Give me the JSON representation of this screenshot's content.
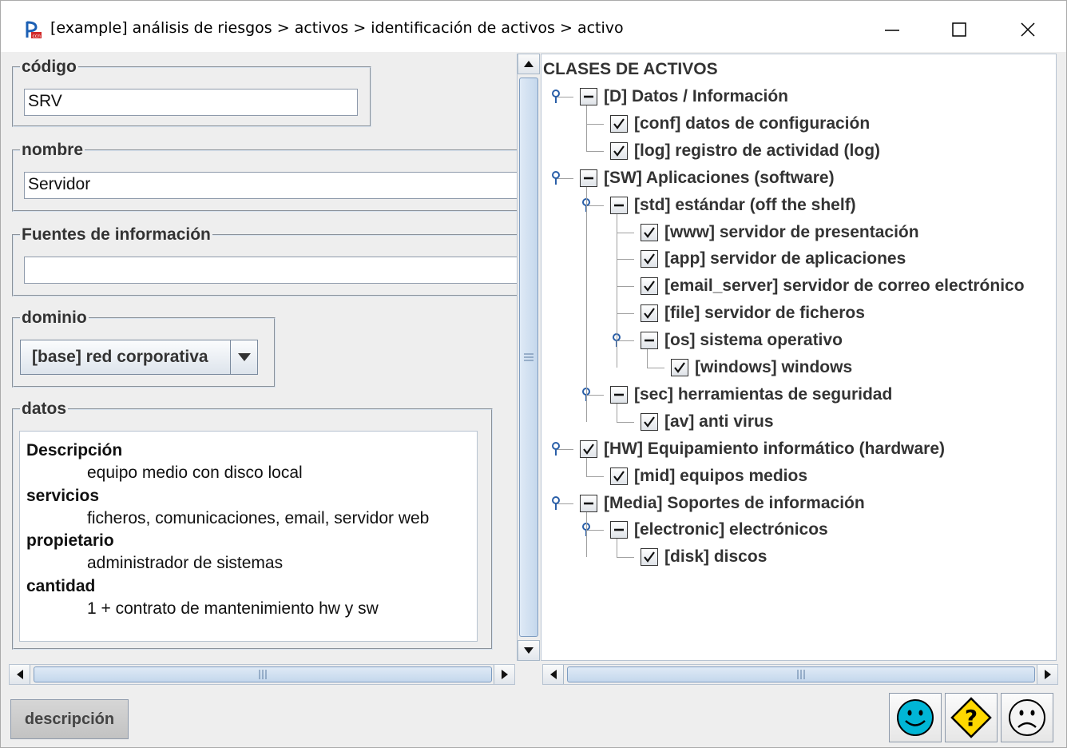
{
  "window": {
    "title": "[example] análisis de riesgos > activos > identificación de activos > activo",
    "icon": "pilar-app-icon"
  },
  "form": {
    "codigo": {
      "label": "código",
      "value": "SRV"
    },
    "nombre": {
      "label": "nombre",
      "value": "Servidor"
    },
    "fuentes": {
      "label": "Fuentes de información",
      "value": ""
    },
    "dominio": {
      "label": "dominio",
      "selected": "[base] red corporativa"
    },
    "datos": {
      "label": "datos",
      "lines": [
        {
          "text": "Descripción",
          "kind": "hd"
        },
        {
          "text": "equipo medio con disco local",
          "kind": "val"
        },
        {
          "text": "servicios",
          "kind": "hd"
        },
        {
          "text": "ficheros, comunicaciones, email, servidor web",
          "kind": "val"
        },
        {
          "text": "propietario",
          "kind": "hd"
        },
        {
          "text": "administrador de sistemas",
          "kind": "val"
        },
        {
          "text": "cantidad",
          "kind": "hd"
        },
        {
          "text": "1 + contrato de mantenimiento hw y sw",
          "kind": "val"
        }
      ]
    }
  },
  "tree": {
    "root": "CLASES DE ACTIVOS",
    "nodes": [
      {
        "label": "[D] Datos / Información",
        "level": 0,
        "state": "partial",
        "expandable": true
      },
      {
        "label": "[conf] datos de configuración",
        "level": 1,
        "state": "checked",
        "expandable": false
      },
      {
        "label": "[log] registro de actividad (log)",
        "level": 1,
        "state": "checked",
        "expandable": false
      },
      {
        "label": "[SW] Aplicaciones (software)",
        "level": 0,
        "state": "partial",
        "expandable": true
      },
      {
        "label": "[std] estándar (off the shelf)",
        "level": 1,
        "state": "partial",
        "expandable": true
      },
      {
        "label": "[www] servidor de presentación",
        "level": 2,
        "state": "checked",
        "expandable": false
      },
      {
        "label": "[app] servidor de aplicaciones",
        "level": 2,
        "state": "checked",
        "expandable": false
      },
      {
        "label": "[email_server] servidor de correo electrónico",
        "level": 2,
        "state": "checked",
        "expandable": false
      },
      {
        "label": "[file] servidor de ficheros",
        "level": 2,
        "state": "checked",
        "expandable": false
      },
      {
        "label": "[os] sistema operativo",
        "level": 2,
        "state": "partial",
        "expandable": true
      },
      {
        "label": "[windows] windows",
        "level": 3,
        "state": "checked",
        "expandable": false
      },
      {
        "label": "[sec] herramientas de seguridad",
        "level": 1,
        "state": "partial",
        "expandable": true
      },
      {
        "label": "[av] anti virus",
        "level": 2,
        "state": "checked",
        "expandable": false
      },
      {
        "label": "[HW] Equipamiento informático (hardware)",
        "level": 0,
        "state": "checked",
        "expandable": true
      },
      {
        "label": "[mid] equipos medios",
        "level": 1,
        "state": "checked",
        "expandable": false
      },
      {
        "label": "[Media] Soportes de información",
        "level": 0,
        "state": "partial",
        "expandable": true
      },
      {
        "label": "[electronic] electrónicos",
        "level": 1,
        "state": "partial",
        "expandable": true
      },
      {
        "label": "[disk] discos",
        "level": 2,
        "state": "checked",
        "expandable": false
      }
    ]
  },
  "buttons": {
    "descripcion": "descripción",
    "ok_icon": "smiley-ok-icon",
    "help_icon": "question-diamond-icon",
    "cancel_icon": "sad-face-icon"
  },
  "colors": {
    "ok": "#00b6d6",
    "help": "#ffd800",
    "accent": "#c4d7ec"
  }
}
